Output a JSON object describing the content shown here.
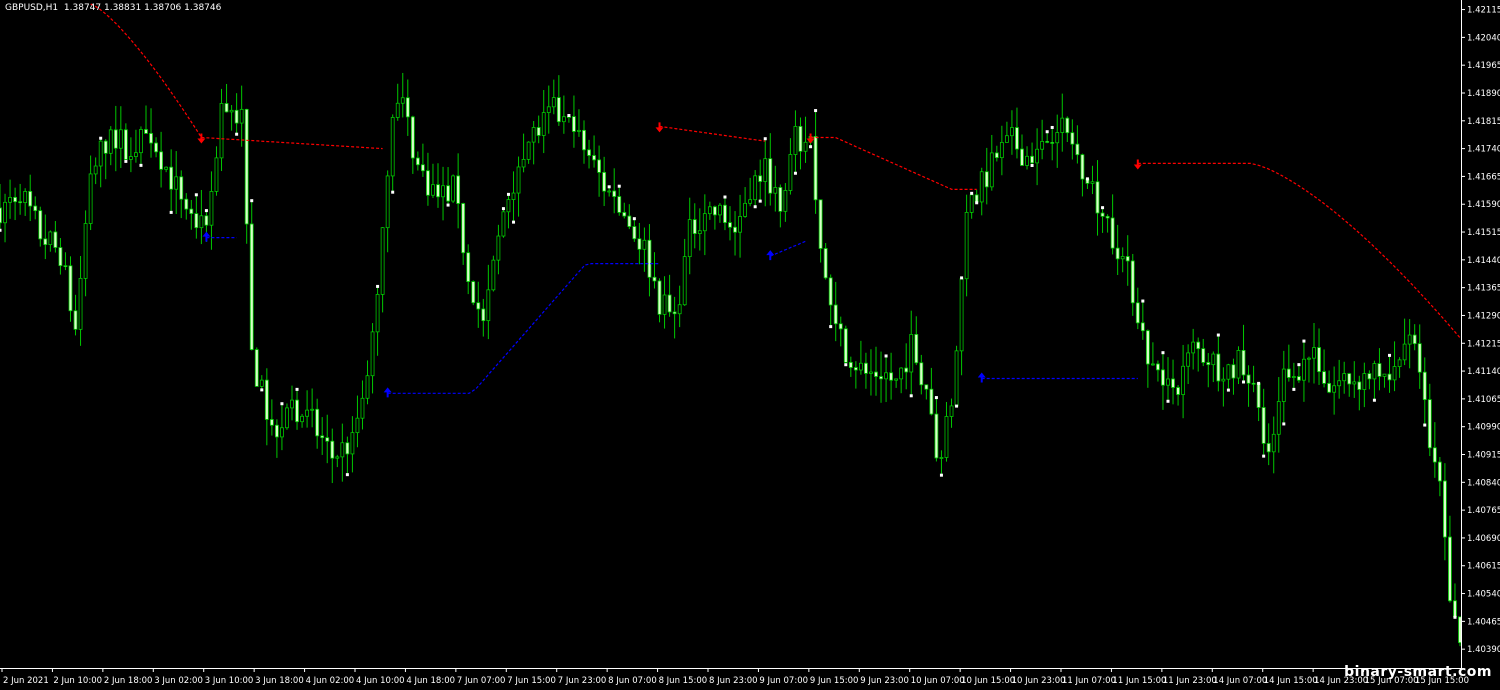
{
  "header": {
    "symbol": "GBPUSD,H1",
    "ohlc": "1.38747 1.38831 1.38706 1.38746"
  },
  "watermark": "binary-smart.com",
  "colors": {
    "background": "#000000",
    "axis": "#ffffff",
    "candle": "#00c800",
    "candle_body": "#d8ffc8",
    "wick_dot": "#ffffff",
    "down_signal": "#ff0000",
    "up_signal": "#0000ff"
  },
  "chart_data": {
    "type": "candlestick",
    "symbol": "GBPUSD",
    "timeframe": "H1",
    "ylim": [
      1.4035,
      1.4213
    ],
    "y_ticks": [
      "1.42115",
      "1.42040",
      "1.41965",
      "1.41890",
      "1.41815",
      "1.41740",
      "1.41665",
      "1.41590",
      "1.41515",
      "1.41440",
      "1.41365",
      "1.41290",
      "1.41215",
      "1.41140",
      "1.41065",
      "1.40990",
      "1.40915",
      "1.40840",
      "1.40765",
      "1.40690",
      "1.40615",
      "1.40540",
      "1.40465",
      "1.40390"
    ],
    "x_ticks": [
      "2 Jun 2021",
      "2 Jun 10:00",
      "2 Jun 18:00",
      "3 Jun 02:00",
      "3 Jun 10:00",
      "3 Jun 18:00",
      "4 Jun 02:00",
      "4 Jun 10:00",
      "4 Jun 18:00",
      "7 Jun 07:00",
      "7 Jun 15:00",
      "7 Jun 23:00",
      "8 Jun 07:00",
      "8 Jun 15:00",
      "8 Jun 23:00",
      "9 Jun 07:00",
      "9 Jun 15:00",
      "9 Jun 23:00",
      "10 Jun 07:00",
      "10 Jun 15:00",
      "10 Jun 23:00",
      "11 Jun 07:00",
      "11 Jun 15:00",
      "11 Jun 23:00",
      "14 Jun 07:00",
      "14 Jun 15:00",
      "14 Jun 23:00",
      "15 Jun 07:00",
      "15 Jun 15:00"
    ],
    "x_range": [
      0,
      290
    ],
    "price_path": [
      [
        0,
        1.4158
      ],
      [
        4,
        1.4163
      ],
      [
        8,
        1.4151
      ],
      [
        12,
        1.4146
      ],
      [
        15,
        1.4125
      ],
      [
        18,
        1.4168
      ],
      [
        22,
        1.4178
      ],
      [
        26,
        1.4174
      ],
      [
        30,
        1.4178
      ],
      [
        34,
        1.4166
      ],
      [
        38,
        1.4156
      ],
      [
        41,
        1.415
      ],
      [
        44,
        1.4186
      ],
      [
        48,
        1.4182
      ],
      [
        50,
        1.4118
      ],
      [
        54,
        1.4098
      ],
      [
        58,
        1.4105
      ],
      [
        62,
        1.41
      ],
      [
        66,
        1.4091
      ],
      [
        70,
        1.4095
      ],
      [
        74,
        1.4122
      ],
      [
        78,
        1.4185
      ],
      [
        80,
        1.4186
      ],
      [
        83,
        1.4169
      ],
      [
        87,
        1.4161
      ],
      [
        90,
        1.4163
      ],
      [
        93,
        1.4141
      ],
      [
        96,
        1.4126
      ],
      [
        100,
        1.4157
      ],
      [
        104,
        1.4175
      ],
      [
        107,
        1.4179
      ],
      [
        110,
        1.4184
      ],
      [
        113,
        1.418
      ],
      [
        117,
        1.4172
      ],
      [
        120,
        1.4164
      ],
      [
        124,
        1.4156
      ],
      [
        128,
        1.4147
      ],
      [
        131,
        1.4133
      ],
      [
        134,
        1.4128
      ],
      [
        137,
        1.4151
      ],
      [
        140,
        1.4158
      ],
      [
        143,
        1.4156
      ],
      [
        146,
        1.4152
      ],
      [
        149,
        1.4164
      ],
      [
        152,
        1.4168
      ],
      [
        155,
        1.4161
      ],
      [
        158,
        1.4176
      ],
      [
        161,
        1.4176
      ],
      [
        163,
        1.4147
      ],
      [
        166,
        1.4125
      ],
      [
        169,
        1.4118
      ],
      [
        172,
        1.4113
      ],
      [
        175,
        1.4114
      ],
      [
        178,
        1.4111
      ],
      [
        181,
        1.4121
      ],
      [
        184,
        1.411
      ],
      [
        186,
        1.409
      ],
      [
        189,
        1.4103
      ],
      [
        192,
        1.4155
      ],
      [
        195,
        1.4164
      ],
      [
        198,
        1.4172
      ],
      [
        201,
        1.4176
      ],
      [
        204,
        1.4172
      ],
      [
        207,
        1.4174
      ],
      [
        210,
        1.4182
      ],
      [
        213,
        1.4175
      ],
      [
        216,
        1.4167
      ],
      [
        219,
        1.4157
      ],
      [
        222,
        1.4148
      ],
      [
        225,
        1.4136
      ],
      [
        228,
        1.4118
      ],
      [
        231,
        1.4108
      ],
      [
        234,
        1.4111
      ],
      [
        237,
        1.412
      ],
      [
        240,
        1.4118
      ],
      [
        243,
        1.4114
      ],
      [
        246,
        1.4116
      ],
      [
        249,
        1.4109
      ],
      [
        252,
        1.4089
      ],
      [
        255,
        1.4112
      ],
      [
        258,
        1.4115
      ],
      [
        261,
        1.412
      ],
      [
        264,
        1.4109
      ],
      [
        267,
        1.4112
      ],
      [
        270,
        1.4112
      ],
      [
        273,
        1.4114
      ],
      [
        276,
        1.4112
      ],
      [
        279,
        1.4123
      ],
      [
        282,
        1.4116
      ],
      [
        284,
        1.4092
      ],
      [
        286,
        1.4082
      ],
      [
        288,
        1.405
      ],
      [
        290,
        1.404
      ]
    ],
    "down_signals": [
      {
        "x0": 40,
        "y0": 1.4177,
        "x1": 76,
        "y1": 1.4174,
        "shape": "flat"
      },
      {
        "x0": 131,
        "y0": 1.418,
        "x1": 152,
        "y1": 1.4176,
        "shape": "flat"
      },
      {
        "x0": 161,
        "y0": 1.4177,
        "x1": 194,
        "y1": 1.4163,
        "shape": "descend"
      },
      {
        "x0": 226,
        "y0": 1.417,
        "x1": 290,
        "y1": 1.4123,
        "shape": "curve"
      }
    ],
    "down_lead_in": {
      "x0": 18,
      "y0": 1.4213,
      "x1": 40,
      "y1": 1.4177
    },
    "up_signals": [
      {
        "x0": 41,
        "y0": 1.415,
        "x1": 47,
        "y1": 1.415,
        "shape": "flat"
      },
      {
        "x0": 77,
        "y0": 1.4108,
        "x1": 131,
        "y1": 1.4143,
        "shape": "ramp"
      },
      {
        "x0": 153,
        "y0": 1.4145,
        "x1": 160,
        "y1": 1.4149,
        "shape": "flat"
      },
      {
        "x0": 195,
        "y0": 1.4112,
        "x1": 226,
        "y1": 1.4112,
        "shape": "flat"
      }
    ]
  }
}
